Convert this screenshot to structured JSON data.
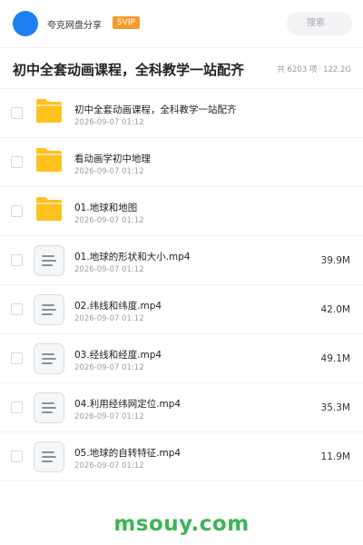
{
  "header": {
    "app_name": "夸克网盘分享",
    "badge": "SVIP",
    "search_placeholder": "搜索"
  },
  "title_bar": {
    "title": "初中全套动画课程，全科教学一站配齐",
    "item_count": "共 6203 项",
    "separator": "·",
    "total_size": "122.2G"
  },
  "colors": {
    "avatar": "#1e7ff0",
    "badge_bg": "#f39b2c",
    "folder": "#ffc11c",
    "brand_watermark": "#3cb554"
  },
  "files": [
    {
      "type": "folder",
      "icon": "folder-icon",
      "name": "初中全套动画课程，全科教学一站配齐",
      "date": "2026-09-07 01:12",
      "size": ""
    },
    {
      "type": "folder",
      "icon": "folder-icon",
      "name": "看动画学初中地理",
      "date": "2026-09-07 01:12",
      "size": ""
    },
    {
      "type": "folder",
      "icon": "folder-icon",
      "name": "01.地球和地图",
      "date": "2026-09-07 01:12",
      "size": ""
    },
    {
      "type": "file",
      "icon": "document-icon",
      "name": "01.地球的形状和大小.mp4",
      "date": "2026-09-07 01:12",
      "size": "39.9M"
    },
    {
      "type": "file",
      "icon": "document-icon",
      "name": "02.纬线和纬度.mp4",
      "date": "2026-09-07 01:12",
      "size": "42.0M"
    },
    {
      "type": "file",
      "icon": "document-icon",
      "name": "03.经线和经度.mp4",
      "date": "2026-09-07 01:12",
      "size": "49.1M"
    },
    {
      "type": "file",
      "icon": "document-icon",
      "name": "04.利用经纬网定位.mp4",
      "date": "2026-09-07 01:12",
      "size": "35.3M"
    },
    {
      "type": "file",
      "icon": "document-icon",
      "name": "05.地球的自转特征.mp4",
      "date": "2026-09-07 01:12",
      "size": "11.9M"
    }
  ],
  "watermark": "msouy.com"
}
